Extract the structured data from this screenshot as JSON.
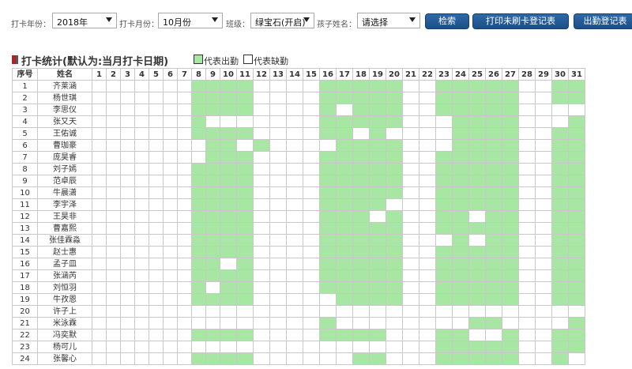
{
  "filters": {
    "year_label": "打卡年份：",
    "year_value": "2018年",
    "month_label": "打卡月份：",
    "month_value": "10月份",
    "class_label": "班级：",
    "class_value": "绿宝石(开启)",
    "child_label": "孩子姓名：",
    "child_value": "请选择"
  },
  "buttons": {
    "search": "检索",
    "print_unpunched": "打印未刷卡登记表",
    "attendance_register": "出勤登记表"
  },
  "section": {
    "title": "打卡统计(默认为:当月打卡日期)",
    "legend_present": "代表出勤",
    "legend_absent": "代表缺勤"
  },
  "colors": {
    "present": "#a8e6a3",
    "absent": "#ffffff",
    "button": "#1f5a96",
    "marker": "#b32222"
  },
  "table": {
    "col_index": "序号",
    "col_name": "姓名",
    "days": [
      "1",
      "2",
      "3",
      "4",
      "5",
      "6",
      "7",
      "8",
      "9",
      "10",
      "11",
      "12",
      "13",
      "14",
      "15",
      "16",
      "17",
      "18",
      "19",
      "20",
      "21",
      "22",
      "23",
      "24",
      "25",
      "26",
      "27",
      "28",
      "29",
      "30",
      "31"
    ],
    "rows": [
      {
        "no": "1",
        "name": "齐莱涵",
        "att": "0000000111100001111100111110011"
      },
      {
        "no": "2",
        "name": "杨世琪",
        "att": "0000000111100001111100111110011"
      },
      {
        "no": "3",
        "name": "李思仪",
        "att": "0000000111100001011100111110000"
      },
      {
        "no": "4",
        "name": "张又天",
        "att": "0000000100000001111100011110001"
      },
      {
        "no": "5",
        "name": "王佑诚",
        "att": "0000000111100001101000011110011"
      },
      {
        "no": "6",
        "name": "曹珈豪",
        "att": "0000000011010000111100011110011"
      },
      {
        "no": "7",
        "name": "庞昊睿",
        "att": "0000000011100001111100111110011"
      },
      {
        "no": "8",
        "name": "刘子嫣",
        "att": "0000000111100001111100111110011"
      },
      {
        "no": "9",
        "name": "范卓辰",
        "att": "0000000111100001111100111110011"
      },
      {
        "no": "10",
        "name": "牛晨潇",
        "att": "0000000111100001111100111110011"
      },
      {
        "no": "11",
        "name": "李宇泽",
        "att": "0000000111100001111000111110011"
      },
      {
        "no": "12",
        "name": "王昊非",
        "att": "0000000111100001110100110110011"
      },
      {
        "no": "13",
        "name": "曹嘉熙",
        "att": "0000000111100001111100111110011"
      },
      {
        "no": "14",
        "name": "张佳霖淼",
        "att": "0000000111100001111100010110011"
      },
      {
        "no": "15",
        "name": "赵士惠",
        "att": "0000000111100001111100111110011"
      },
      {
        "no": "16",
        "name": "孟子皿",
        "att": "0000000110100001111100111110011"
      },
      {
        "no": "17",
        "name": "张涵芮",
        "att": "0000000111100001111100111110011"
      },
      {
        "no": "18",
        "name": "刘恒羽",
        "att": "0000000101100001111100111110011"
      },
      {
        "no": "19",
        "name": "牛孜恩",
        "att": "0000000111100000111100111110011"
      },
      {
        "no": "20",
        "name": "许子上",
        "att": "0000000000000000000000000000000"
      },
      {
        "no": "21",
        "name": "米泳霖",
        "att": "0000000000000001000000001100001"
      },
      {
        "no": "22",
        "name": "冯奕默",
        "att": "0000000111100001111000110010011"
      },
      {
        "no": "23",
        "name": "杨可儿",
        "att": "0000000000000000000000111110011"
      },
      {
        "no": "24",
        "name": "张馨心",
        "att": "0000000111100000011000111110010"
      }
    ]
  }
}
